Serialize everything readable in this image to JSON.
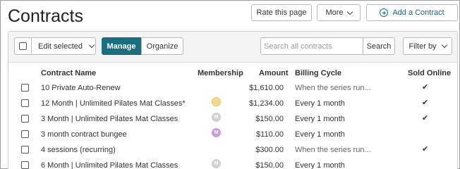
{
  "page": {
    "title": "Contracts"
  },
  "header_buttons": {
    "rate": "Rate this page",
    "more": "More",
    "add": "Add a Contract"
  },
  "toolbar": {
    "edit_selected": "Edit selected",
    "tabs": [
      "Manage",
      "Organize"
    ],
    "active_tab": "Manage",
    "search_placeholder": "Search all contracts",
    "search_button": "Search",
    "filter_button": "Filter by"
  },
  "table": {
    "columns": [
      "Contract Name",
      "Membership",
      "Amount",
      "Billing Cycle",
      "Sold Online"
    ],
    "rows": [
      {
        "name": "10 Private Auto-Renew",
        "membership": "",
        "amount": "$1,610.00",
        "billing": "When the series run...",
        "sold_online": "✔"
      },
      {
        "name": "12 Month | Unlimited Pilates Mat Classes*",
        "membership": "",
        "amount": "$1,234.00",
        "billing": "Every 1 month",
        "sold_online": "✔"
      },
      {
        "name": "3 Month | Unlimited Pilates Mat Classes",
        "membership": "M",
        "amount": "$150.00",
        "billing": "Every 1 month",
        "sold_online": "✔"
      },
      {
        "name": "3 month contract bungee",
        "membership": "M",
        "amount": "$110.00",
        "billing": "Every 1 month",
        "sold_online": ""
      },
      {
        "name": "4 sessions (recurring)",
        "membership": "",
        "amount": "$300.00",
        "billing": "When the series run...",
        "sold_online": "✔"
      },
      {
        "name": "6 Month | Unlimited Pilates Mat Classes",
        "membership": "M",
        "amount": "$150.00",
        "billing": "Every 1 month",
        "sold_online": ""
      }
    ]
  },
  "colors": {
    "accent": "#1b6e7f",
    "badge_yellow": "#f6d98a",
    "badge_gray": "#d0d0d0",
    "badge_purple": "#c89be0"
  }
}
